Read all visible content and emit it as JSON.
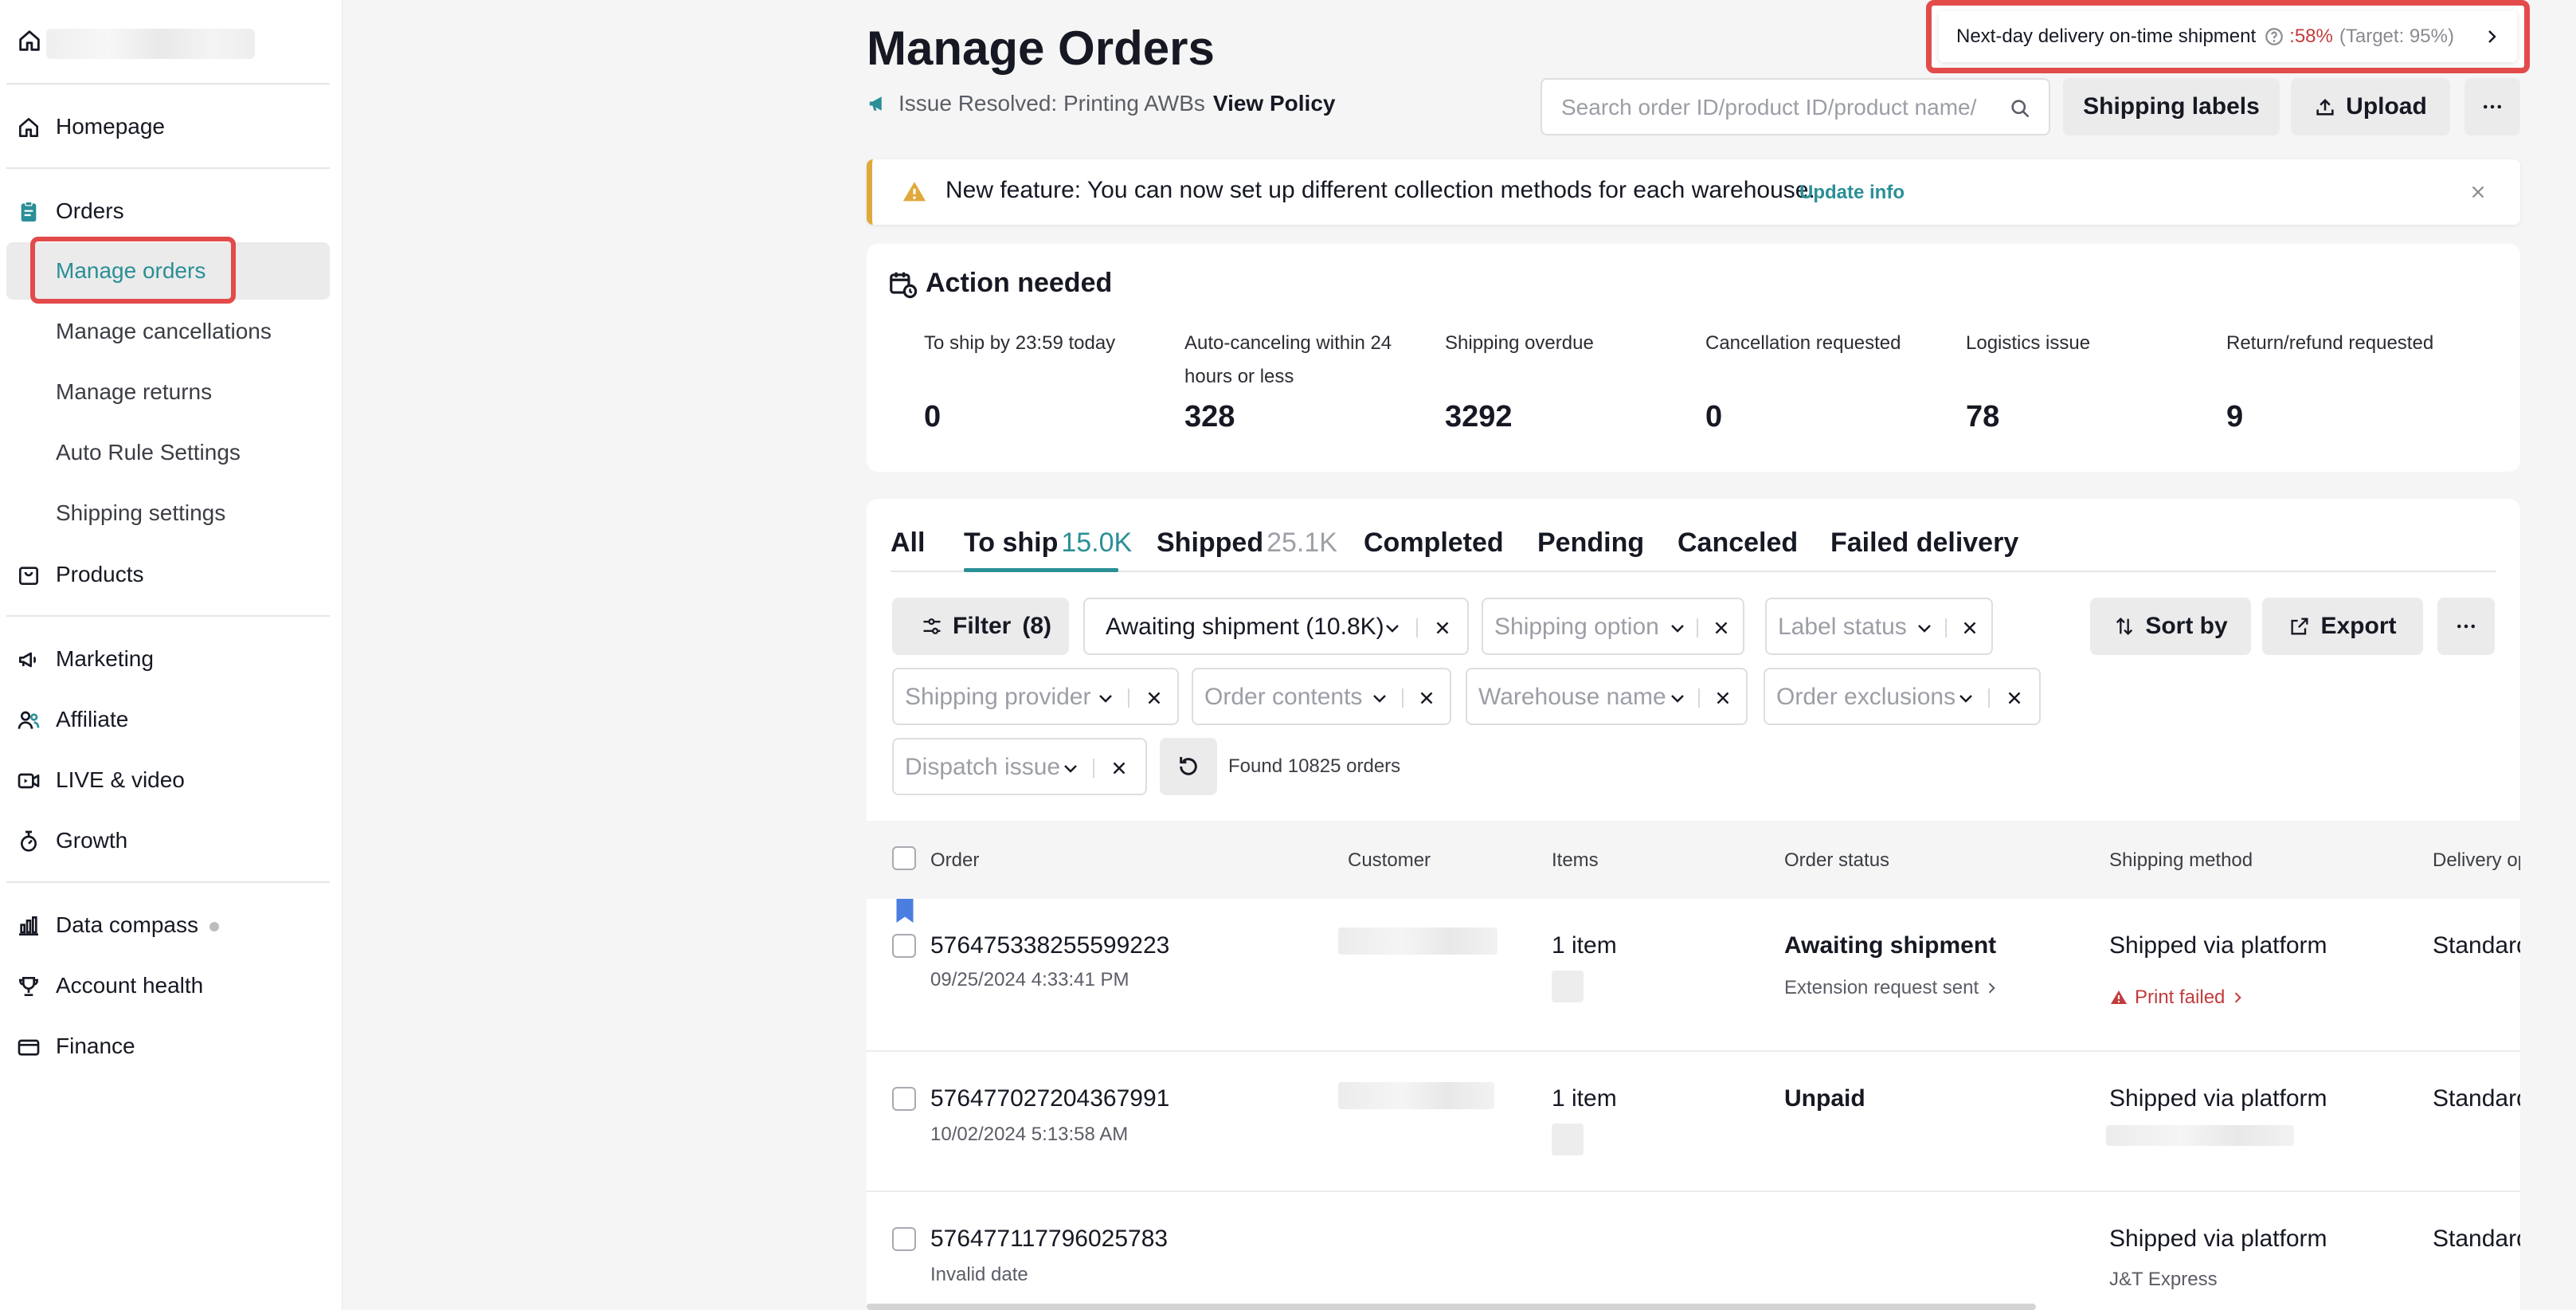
{
  "sidebar": {
    "nav": [
      {
        "id": "homepage",
        "label": "Homepage",
        "icon": "home-icon"
      },
      {
        "id": "orders",
        "label": "Orders",
        "icon": "clipboard-icon"
      },
      {
        "id": "products",
        "label": "Products",
        "icon": "bag-icon"
      },
      {
        "id": "marketing",
        "label": "Marketing",
        "icon": "megaphone-icon"
      },
      {
        "id": "affiliate",
        "label": "Affiliate",
        "icon": "users-icon"
      },
      {
        "id": "live",
        "label": "LIVE & video",
        "icon": "video-icon"
      },
      {
        "id": "growth",
        "label": "Growth",
        "icon": "growth-icon"
      },
      {
        "id": "datacompass",
        "label": "Data compass",
        "icon": "chart-icon"
      },
      {
        "id": "accounthealth",
        "label": "Account health",
        "icon": "trophy-icon"
      },
      {
        "id": "finance",
        "label": "Finance",
        "icon": "wallet-icon"
      }
    ],
    "orders_sub": [
      {
        "label": "Manage orders",
        "active": true
      },
      {
        "label": "Manage cancellations"
      },
      {
        "label": "Manage returns"
      },
      {
        "label": "Auto Rule Settings"
      },
      {
        "label": "Shipping settings"
      }
    ]
  },
  "header": {
    "title": "Manage Orders",
    "issue_text": "Issue Resolved: Printing AWBs",
    "issue_link": "View Policy",
    "kpi_label": "Next-day delivery on-time shipment",
    "kpi_value": "58%",
    "kpi_target": "(Target: 95%)",
    "search_placeholder": "Search order ID/product ID/product name/",
    "shipping_labels": "Shipping labels",
    "upload": "Upload"
  },
  "notice": {
    "text": "New feature: You can now set up different collection methods for each warehouse.",
    "link": "Update info"
  },
  "action_needed": {
    "title": "Action needed",
    "metrics": [
      {
        "label": "To ship by 23:59 today",
        "value": "0"
      },
      {
        "label": "Auto-canceling within 24 hours or less",
        "value": "328"
      },
      {
        "label": "Shipping overdue",
        "value": "3292"
      },
      {
        "label": "Cancellation requested",
        "value": "0"
      },
      {
        "label": "Logistics issue",
        "value": "78"
      },
      {
        "label": "Return/refund requested",
        "value": "9"
      }
    ]
  },
  "tabs": [
    {
      "label": "All"
    },
    {
      "label": "To ship",
      "count": "15.0K",
      "active": true
    },
    {
      "label": "Shipped",
      "count": "25.1K"
    },
    {
      "label": "Completed"
    },
    {
      "label": "Pending"
    },
    {
      "label": "Canceled"
    },
    {
      "label": "Failed delivery"
    }
  ],
  "filters": {
    "filter_btn": "Filter",
    "filter_count": "(8)",
    "awaiting": "Awaiting shipment (10.8K)",
    "shipping_option": "Shipping option",
    "label_status": "Label status",
    "shipping_provider": "Shipping provider",
    "order_contents": "Order contents",
    "warehouse_name": "Warehouse name",
    "order_exclusions": "Order exclusions",
    "dispatch_issue": "Dispatch issue",
    "found": "Found 10825 orders",
    "sort_by": "Sort by",
    "export": "Export"
  },
  "table": {
    "columns": [
      "Order",
      "Customer",
      "Items",
      "Order status",
      "Shipping method",
      "Delivery option"
    ],
    "rows": [
      {
        "order_id": "576475338255599223",
        "date": "09/25/2024 4:33:41 PM",
        "items": "1 item",
        "status": "Awaiting shipment",
        "status_sub": "Extension request sent",
        "shipping": "Shipped via platform",
        "shipping_sub": "Print failed",
        "delivery": "Standard"
      },
      {
        "order_id": "576477027204367991",
        "date": "10/02/2024 5:13:58 AM",
        "items": "1 item",
        "status": "Unpaid",
        "shipping": "Shipped via platform",
        "delivery": "Standard"
      },
      {
        "order_id": "576477117796025783",
        "date": "Invalid date",
        "shipping": "Shipped via platform",
        "shipping_sub": "J&T Express",
        "delivery": "Standard"
      }
    ]
  },
  "colors": {
    "accent": "#2a8f97",
    "highlight": "#e34b4b",
    "warning": "#e0a93b",
    "error": "#c23c3c"
  }
}
